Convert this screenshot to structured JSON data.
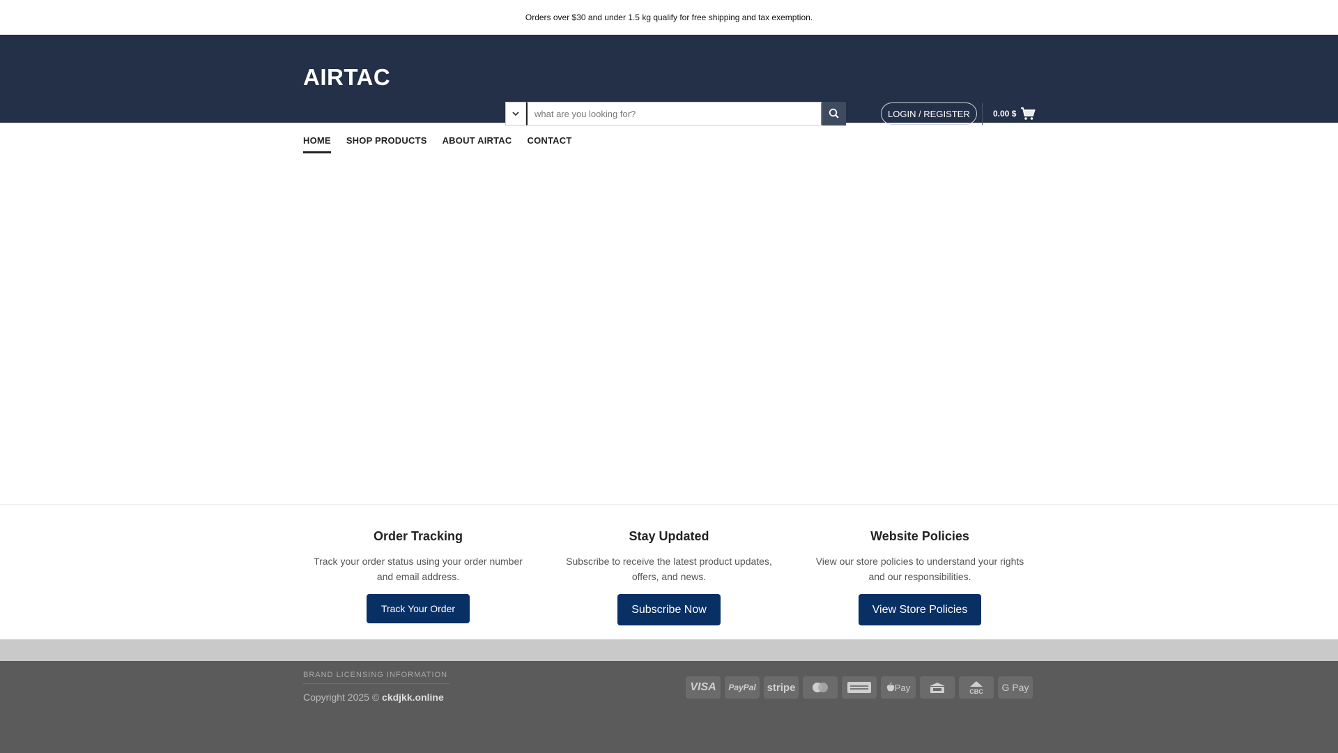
{
  "topbar": {
    "notice": "Orders over $30 and under 1.5 kg qualify for free shipping and tax exemption."
  },
  "header": {
    "logo": "AIRTAC",
    "search": {
      "placeholder": "what are you looking for?"
    },
    "login_label": "LOGIN / REGISTER",
    "cart_total": "0.00 $"
  },
  "nav": [
    {
      "label": "HOME",
      "active": true
    },
    {
      "label": "SHOP PRODUCTS",
      "active": false
    },
    {
      "label": "ABOUT AIRTAC",
      "active": false
    },
    {
      "label": "CONTACT",
      "active": false
    }
  ],
  "features": [
    {
      "title": "Order Tracking",
      "text": "Track your order status using your order number and email address.",
      "button": "Track Your Order"
    },
    {
      "title": "Stay Updated",
      "text": "Subscribe to receive the latest product updates, offers, and news.",
      "button": "Subscribe Now"
    },
    {
      "title": "Website Policies",
      "text": "View our store policies to understand your rights and our responsibilities.",
      "button": "View Store Policies"
    }
  ],
  "footer": {
    "licensing": "BRAND LICENSING INFORMATION",
    "copyright_prefix": "Copyright 2025 ©",
    "copyright_site": "ckdjkk.online",
    "payment_icons": [
      {
        "name": "visa-icon",
        "label": "VISA"
      },
      {
        "name": "paypal-icon",
        "label": "PayPal"
      },
      {
        "name": "stripe-icon",
        "label": "stripe"
      },
      {
        "name": "mastercard-icon",
        "label": ""
      },
      {
        "name": "amex-icon",
        "label": ""
      },
      {
        "name": "apple-pay-icon",
        "label": " Pay"
      },
      {
        "name": "bank-card-icon",
        "label": ""
      },
      {
        "name": "cbc-icon",
        "label": "CBC"
      },
      {
        "name": "google-pay-icon",
        "label": "G Pay"
      }
    ]
  },
  "colors": {
    "header_bg": "#243047",
    "button_bg": "#083064",
    "footer_bg": "#5b5b5b"
  }
}
